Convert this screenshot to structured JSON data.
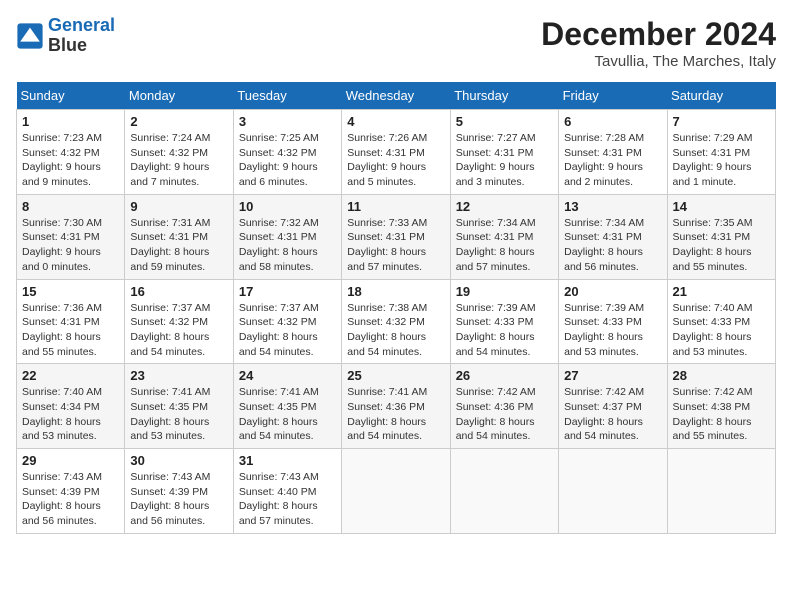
{
  "header": {
    "logo_line1": "General",
    "logo_line2": "Blue",
    "month_title": "December 2024",
    "location": "Tavullia, The Marches, Italy"
  },
  "weekdays": [
    "Sunday",
    "Monday",
    "Tuesday",
    "Wednesday",
    "Thursday",
    "Friday",
    "Saturday"
  ],
  "weeks": [
    [
      {
        "day": "1",
        "sunrise": "Sunrise: 7:23 AM",
        "sunset": "Sunset: 4:32 PM",
        "daylight": "Daylight: 9 hours and 9 minutes."
      },
      {
        "day": "2",
        "sunrise": "Sunrise: 7:24 AM",
        "sunset": "Sunset: 4:32 PM",
        "daylight": "Daylight: 9 hours and 7 minutes."
      },
      {
        "day": "3",
        "sunrise": "Sunrise: 7:25 AM",
        "sunset": "Sunset: 4:32 PM",
        "daylight": "Daylight: 9 hours and 6 minutes."
      },
      {
        "day": "4",
        "sunrise": "Sunrise: 7:26 AM",
        "sunset": "Sunset: 4:31 PM",
        "daylight": "Daylight: 9 hours and 5 minutes."
      },
      {
        "day": "5",
        "sunrise": "Sunrise: 7:27 AM",
        "sunset": "Sunset: 4:31 PM",
        "daylight": "Daylight: 9 hours and 3 minutes."
      },
      {
        "day": "6",
        "sunrise": "Sunrise: 7:28 AM",
        "sunset": "Sunset: 4:31 PM",
        "daylight": "Daylight: 9 hours and 2 minutes."
      },
      {
        "day": "7",
        "sunrise": "Sunrise: 7:29 AM",
        "sunset": "Sunset: 4:31 PM",
        "daylight": "Daylight: 9 hours and 1 minute."
      }
    ],
    [
      {
        "day": "8",
        "sunrise": "Sunrise: 7:30 AM",
        "sunset": "Sunset: 4:31 PM",
        "daylight": "Daylight: 9 hours and 0 minutes."
      },
      {
        "day": "9",
        "sunrise": "Sunrise: 7:31 AM",
        "sunset": "Sunset: 4:31 PM",
        "daylight": "Daylight: 8 hours and 59 minutes."
      },
      {
        "day": "10",
        "sunrise": "Sunrise: 7:32 AM",
        "sunset": "Sunset: 4:31 PM",
        "daylight": "Daylight: 8 hours and 58 minutes."
      },
      {
        "day": "11",
        "sunrise": "Sunrise: 7:33 AM",
        "sunset": "Sunset: 4:31 PM",
        "daylight": "Daylight: 8 hours and 57 minutes."
      },
      {
        "day": "12",
        "sunrise": "Sunrise: 7:34 AM",
        "sunset": "Sunset: 4:31 PM",
        "daylight": "Daylight: 8 hours and 57 minutes."
      },
      {
        "day": "13",
        "sunrise": "Sunrise: 7:34 AM",
        "sunset": "Sunset: 4:31 PM",
        "daylight": "Daylight: 8 hours and 56 minutes."
      },
      {
        "day": "14",
        "sunrise": "Sunrise: 7:35 AM",
        "sunset": "Sunset: 4:31 PM",
        "daylight": "Daylight: 8 hours and 55 minutes."
      }
    ],
    [
      {
        "day": "15",
        "sunrise": "Sunrise: 7:36 AM",
        "sunset": "Sunset: 4:31 PM",
        "daylight": "Daylight: 8 hours and 55 minutes."
      },
      {
        "day": "16",
        "sunrise": "Sunrise: 7:37 AM",
        "sunset": "Sunset: 4:32 PM",
        "daylight": "Daylight: 8 hours and 54 minutes."
      },
      {
        "day": "17",
        "sunrise": "Sunrise: 7:37 AM",
        "sunset": "Sunset: 4:32 PM",
        "daylight": "Daylight: 8 hours and 54 minutes."
      },
      {
        "day": "18",
        "sunrise": "Sunrise: 7:38 AM",
        "sunset": "Sunset: 4:32 PM",
        "daylight": "Daylight: 8 hours and 54 minutes."
      },
      {
        "day": "19",
        "sunrise": "Sunrise: 7:39 AM",
        "sunset": "Sunset: 4:33 PM",
        "daylight": "Daylight: 8 hours and 54 minutes."
      },
      {
        "day": "20",
        "sunrise": "Sunrise: 7:39 AM",
        "sunset": "Sunset: 4:33 PM",
        "daylight": "Daylight: 8 hours and 53 minutes."
      },
      {
        "day": "21",
        "sunrise": "Sunrise: 7:40 AM",
        "sunset": "Sunset: 4:33 PM",
        "daylight": "Daylight: 8 hours and 53 minutes."
      }
    ],
    [
      {
        "day": "22",
        "sunrise": "Sunrise: 7:40 AM",
        "sunset": "Sunset: 4:34 PM",
        "daylight": "Daylight: 8 hours and 53 minutes."
      },
      {
        "day": "23",
        "sunrise": "Sunrise: 7:41 AM",
        "sunset": "Sunset: 4:35 PM",
        "daylight": "Daylight: 8 hours and 53 minutes."
      },
      {
        "day": "24",
        "sunrise": "Sunrise: 7:41 AM",
        "sunset": "Sunset: 4:35 PM",
        "daylight": "Daylight: 8 hours and 54 minutes."
      },
      {
        "day": "25",
        "sunrise": "Sunrise: 7:41 AM",
        "sunset": "Sunset: 4:36 PM",
        "daylight": "Daylight: 8 hours and 54 minutes."
      },
      {
        "day": "26",
        "sunrise": "Sunrise: 7:42 AM",
        "sunset": "Sunset: 4:36 PM",
        "daylight": "Daylight: 8 hours and 54 minutes."
      },
      {
        "day": "27",
        "sunrise": "Sunrise: 7:42 AM",
        "sunset": "Sunset: 4:37 PM",
        "daylight": "Daylight: 8 hours and 54 minutes."
      },
      {
        "day": "28",
        "sunrise": "Sunrise: 7:42 AM",
        "sunset": "Sunset: 4:38 PM",
        "daylight": "Daylight: 8 hours and 55 minutes."
      }
    ],
    [
      {
        "day": "29",
        "sunrise": "Sunrise: 7:43 AM",
        "sunset": "Sunset: 4:39 PM",
        "daylight": "Daylight: 8 hours and 56 minutes."
      },
      {
        "day": "30",
        "sunrise": "Sunrise: 7:43 AM",
        "sunset": "Sunset: 4:39 PM",
        "daylight": "Daylight: 8 hours and 56 minutes."
      },
      {
        "day": "31",
        "sunrise": "Sunrise: 7:43 AM",
        "sunset": "Sunset: 4:40 PM",
        "daylight": "Daylight: 8 hours and 57 minutes."
      },
      null,
      null,
      null,
      null
    ]
  ]
}
